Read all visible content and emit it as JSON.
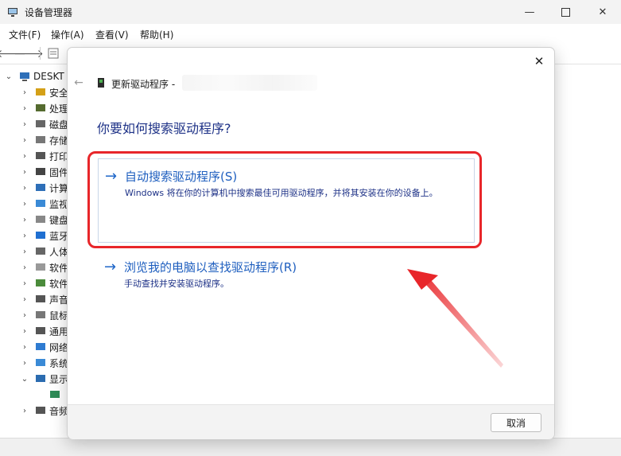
{
  "window": {
    "title": "设备管理器",
    "controls": [
      "minimize-icon",
      "maximize-icon",
      "close-icon"
    ]
  },
  "menu": [
    "文件(F)",
    "操作(A)",
    "查看(V)",
    "帮助(H)"
  ],
  "tree": {
    "root_label": "DESKT",
    "items": [
      {
        "label": "安全",
        "icon": "security-icon"
      },
      {
        "label": "处理",
        "icon": "processor-icon"
      },
      {
        "label": "磁盘",
        "icon": "disk-icon"
      },
      {
        "label": "存储",
        "icon": "storage-icon"
      },
      {
        "label": "打印",
        "icon": "printer-icon"
      },
      {
        "label": "固件",
        "icon": "firmware-icon"
      },
      {
        "label": "计算",
        "icon": "computer-icon"
      },
      {
        "label": "监视",
        "icon": "monitor-icon"
      },
      {
        "label": "键盘",
        "icon": "keyboard-icon"
      },
      {
        "label": "蓝牙",
        "icon": "bluetooth-icon"
      },
      {
        "label": "人体",
        "icon": "hid-icon"
      },
      {
        "label": "软件",
        "icon": "software-device-icon"
      },
      {
        "label": "软件",
        "icon": "software-component-icon"
      },
      {
        "label": "声音",
        "icon": "sound-icon"
      },
      {
        "label": "鼠标",
        "icon": "mouse-icon"
      },
      {
        "label": "通用",
        "icon": "usb-icon"
      },
      {
        "label": "网络",
        "icon": "network-icon"
      },
      {
        "label": "系统",
        "icon": "system-icon"
      },
      {
        "label": "显示",
        "icon": "display-adapter-icon",
        "expanded": true
      },
      {
        "label": "",
        "icon": "display-device-icon",
        "child": true
      },
      {
        "label": "音频",
        "icon": "audio-icon"
      }
    ]
  },
  "dialog": {
    "title_prefix": "更新驱动程序 -",
    "question": "你要如何搜索驱动程序?",
    "option_auto": {
      "arrow": "→",
      "title": "自动搜索驱动程序(S)",
      "desc": "Windows 将在你的计算机中搜索最佳可用驱动程序，并将其安装在你的设备上。"
    },
    "option_browse": {
      "arrow": "→",
      "title": "浏览我的电脑以查找驱动程序(R)",
      "desc": "手动查找并安装驱动程序。"
    },
    "cancel_label": "取消"
  },
  "colors": {
    "annotation_red": "#e8262a",
    "link_blue": "#1f5fbf",
    "heading_blue": "#1e3287"
  }
}
